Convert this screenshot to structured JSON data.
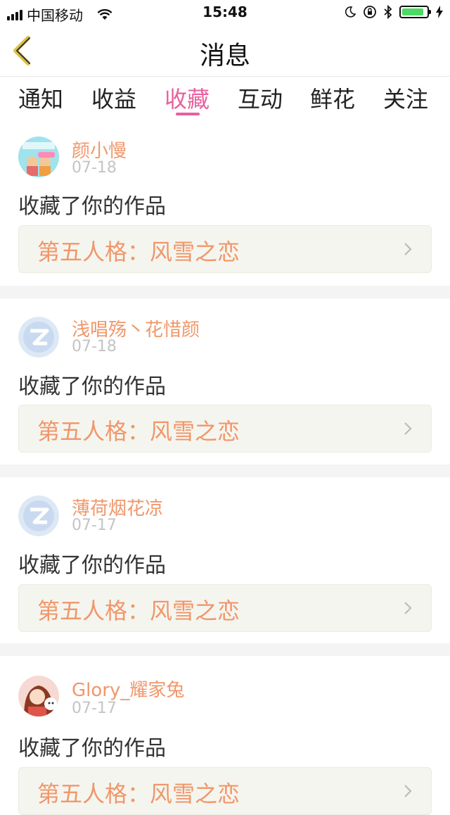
{
  "status_bar": {
    "carrier": "中国移动",
    "time": "15:48"
  },
  "header": {
    "title": "消息",
    "back_icon": "chevron-left-icon"
  },
  "tabs": [
    {
      "label": "通知",
      "active": false
    },
    {
      "label": "收益",
      "active": false
    },
    {
      "label": "收藏",
      "active": true
    },
    {
      "label": "互动",
      "active": false
    },
    {
      "label": "鲜花",
      "active": false
    },
    {
      "label": "关注",
      "active": false
    }
  ],
  "messages": [
    {
      "user": "颜小慢",
      "date": "07-18",
      "action": "收藏了你的作品",
      "work": "第五人格：风雪之恋",
      "avatar": "cartoon-avatar"
    },
    {
      "user": "浅唱殇丶花惜颜",
      "date": "07-18",
      "action": "收藏了你的作品",
      "work": "第五人格：风雪之恋",
      "avatar": "default-qq-avatar"
    },
    {
      "user": "薄荷烟花凉",
      "date": "07-17",
      "action": "收藏了你的作品",
      "work": "第五人格：风雪之恋",
      "avatar": "default-qq-avatar"
    },
    {
      "user": "Glory_耀家兔",
      "date": "07-17",
      "action": "收藏了你的作品",
      "work": "第五人格：风雪之恋",
      "avatar": "girl-avatar"
    }
  ],
  "colors": {
    "accent": "#e9609e",
    "username": "#f0976a",
    "work_bg": "#f5f5ef"
  }
}
